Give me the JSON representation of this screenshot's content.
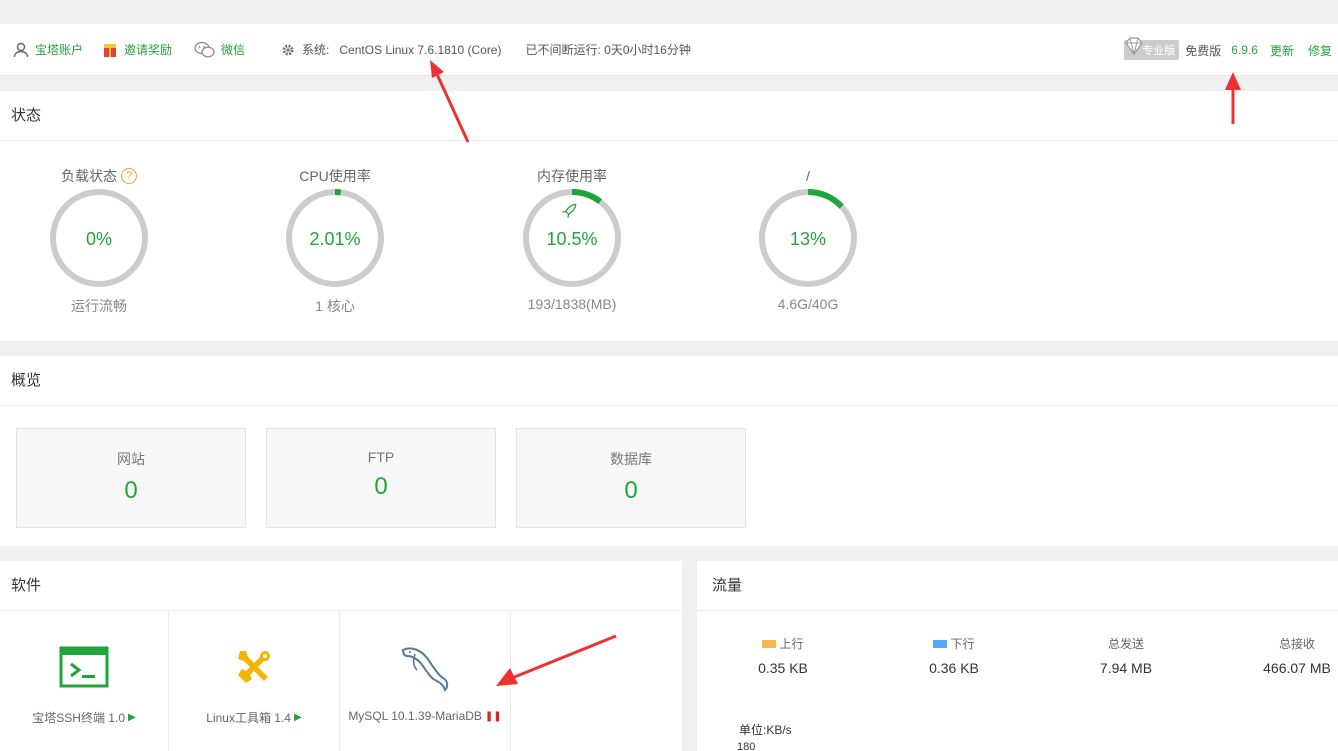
{
  "topbar": {
    "account": "宝塔账户",
    "invite": "邀请奖励",
    "wechat": "微信",
    "system_label": "系统:",
    "system_value": "CentOS Linux 7.6.1810 (Core)",
    "uptime": "已不间断运行: 0天0小时16分钟",
    "pro_label": "专业版",
    "free_label": "免费版",
    "version": "6.9.6",
    "update": "更新",
    "repair": "修复"
  },
  "status": {
    "title": "状态",
    "gauges": [
      {
        "label": "负载状态",
        "percent": 0,
        "display": "0%",
        "sub": "运行流畅",
        "help": "?"
      },
      {
        "label": "CPU使用率",
        "percent": 2.01,
        "display": "2.01%",
        "sub": "1 核心"
      },
      {
        "label": "内存使用率",
        "percent": 10.5,
        "display": "10.5%",
        "sub": "193/1838(MB)"
      },
      {
        "label": "/",
        "percent": 13,
        "display": "13%",
        "sub": "4.6G/40G"
      }
    ]
  },
  "overview": {
    "title": "概览",
    "cards": [
      {
        "title": "网站",
        "value": "0"
      },
      {
        "title": "FTP",
        "value": "0"
      },
      {
        "title": "数据库",
        "value": "0"
      }
    ]
  },
  "software": {
    "title": "软件",
    "items": [
      {
        "name": "宝塔SSH终端 1.0",
        "icon": "terminal-icon"
      },
      {
        "name": "Linux工具箱 1.4",
        "icon": "tools-icon"
      },
      {
        "name": "MySQL 10.1.39-MariaDB",
        "icon": "mysql-dolphin-icon"
      }
    ]
  },
  "traffic": {
    "title": "流量",
    "up_label": "上行",
    "down_label": "下行",
    "total_sent_label": "总发送",
    "total_recv_label": "总接收",
    "up_value": "0.35 KB",
    "down_value": "0.36 KB",
    "total_sent_value": "7.94 MB",
    "total_recv_value": "466.07 MB",
    "unit": "单位:KB/s",
    "axis_tick": "180",
    "colors": {
      "up": "#f7b851",
      "down": "#52a9ff"
    }
  },
  "colors": {
    "accent": "#20a53a",
    "ring": "#cccccc",
    "arrow": "#f03030"
  }
}
